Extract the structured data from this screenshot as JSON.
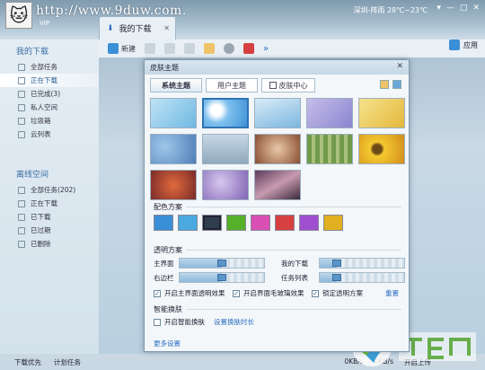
{
  "app": {
    "watermark": "http://www.9duw.com.",
    "weather": "深圳-阵雨 28℃~23℃",
    "window_controls": [
      "▾",
      "—",
      "□",
      "✕"
    ],
    "account_label": "VIP",
    "tab_label": "我的下载",
    "tab_close": "✕"
  },
  "toolbar": {
    "new_label": "新建",
    "more_glyph": "»",
    "apps_label": "应用"
  },
  "sidebar": {
    "section1_title": "我的下载",
    "section1_items": [
      {
        "label": "全部任务"
      },
      {
        "label": "正在下载"
      },
      {
        "label": "已完成(3)"
      },
      {
        "label": "私人空间"
      },
      {
        "label": "垃圾箱"
      },
      {
        "label": "云列表"
      }
    ],
    "section2_title": "离线空间",
    "section2_items": [
      {
        "label": "全部任务(202)"
      },
      {
        "label": "正在下载"
      },
      {
        "label": "已下载"
      },
      {
        "label": "已过期"
      },
      {
        "label": "已删除"
      }
    ]
  },
  "statusbar": {
    "left_items": [
      "下载优先",
      "计划任务"
    ],
    "right_items": [
      "0KB/s",
      "0KB/s",
      "开启上传"
    ]
  },
  "dialog": {
    "title": "皮肤主题",
    "close": "✕",
    "tabs": [
      "系统主题",
      "用户主题",
      "皮肤中心"
    ],
    "color_section": "配色方案",
    "swatch_colors": [
      "#3a8fd6",
      "#4aa9e0",
      "#2f3e4f",
      "#55b02a",
      "#d94fb3",
      "#d64040",
      "#a04fd0",
      "#e0b020"
    ],
    "transparency_section": "透明方案",
    "sliders": [
      {
        "label": "主界面",
        "value": 0.5
      },
      {
        "label": "我的下载",
        "value": 0.2
      },
      {
        "label": "右边栏",
        "value": 0.5
      },
      {
        "label": "任务列表",
        "value": 0.2
      }
    ],
    "checkboxes": [
      {
        "label": "开启主界面透明效果",
        "checked": true
      },
      {
        "label": "开启界面毛玻璃效果",
        "checked": true
      },
      {
        "label": "锁定透明方案",
        "checked": true
      }
    ],
    "reset_label": "重置",
    "smart_section": "智能换肤",
    "smart_checkbox": {
      "label": "开启智能换肤",
      "checked": false
    },
    "smart_link": "设置换肤时长",
    "more_settings": "更多设置"
  }
}
